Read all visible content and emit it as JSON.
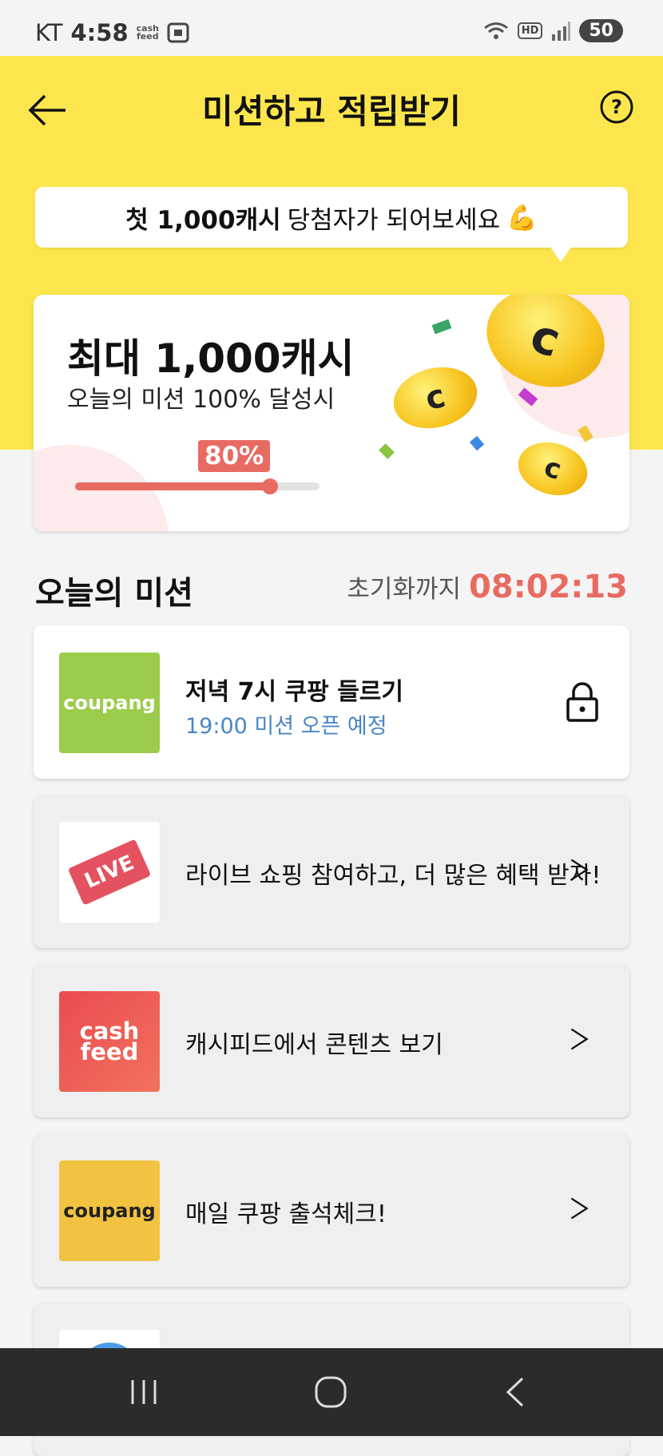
{
  "status": {
    "carrier": "KT",
    "time": "4:58",
    "cashfeed_mini": "cash feed",
    "hd": "HD",
    "battery": "50"
  },
  "header": {
    "title": "미션하고 적립받기"
  },
  "tooltip": {
    "bold": "첫 1,000캐시",
    "rest": "당첨자가 되어보세요",
    "emoji": "💪"
  },
  "reward": {
    "title": "최대 1,000캐시",
    "subtitle": "오늘의 미션 100% 달성시",
    "progress_label": "80%",
    "progress_value": 0.8
  },
  "section": {
    "title": "오늘의 미션",
    "reset_label": "초기화까지",
    "reset_time": "08:02:13"
  },
  "missions": [
    {
      "logo_text": "coupang",
      "title": "저녁 7시 쿠팡 들르기",
      "subtitle": "19:00 미션 오픈 예정",
      "icon": "lock-icon"
    },
    {
      "logo_text": "LIVE",
      "title": "라이브 쇼핑 참여하고, 더 많은 혜택 받자!",
      "icon": "chevron-right-icon"
    },
    {
      "logo_text_1": "cash",
      "logo_text_2": "feed",
      "title": "캐시피드에서 콘텐츠 보기",
      "icon": "chevron-right-icon"
    },
    {
      "logo_text": "coupang",
      "title": "매일 쿠팡 출석체크!",
      "icon": "chevron-right-icon"
    }
  ],
  "colors": {
    "yellow": "#fde64d",
    "accent_red": "#e86b62",
    "green_logo": "#9ccc4c",
    "orange_logo": "#f2c241",
    "blue_sub": "#4a86c5"
  }
}
